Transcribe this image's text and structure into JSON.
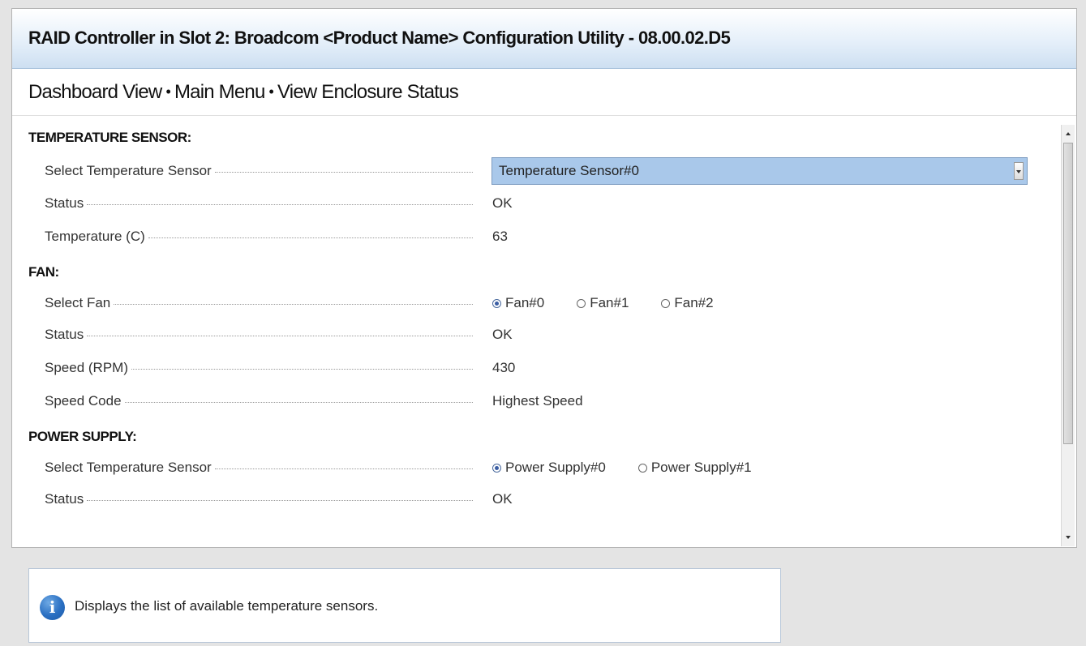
{
  "window": {
    "title": "RAID Controller in Slot 2: Broadcom <Product Name> Configuration Utility - 08.00.02.D5"
  },
  "breadcrumb": {
    "items": [
      "Dashboard View",
      "Main Menu",
      "View Enclosure Status"
    ],
    "separator": "•"
  },
  "temperature_sensor": {
    "heading": "TEMPERATURE SENSOR:",
    "select_label": "Select Temperature Sensor",
    "select_value": "Temperature Sensor#0",
    "status_label": "Status",
    "status_value": "OK",
    "temperature_label": "Temperature (C)",
    "temperature_value": "63"
  },
  "fan": {
    "heading": "FAN:",
    "select_label": "Select Fan",
    "options": [
      "Fan#0",
      "Fan#1",
      "Fan#2"
    ],
    "selected_option": "Fan#0",
    "status_label": "Status",
    "status_value": "OK",
    "speed_label": "Speed (RPM)",
    "speed_value": "430",
    "speed_code_label": "Speed Code",
    "speed_code_value": "Highest Speed"
  },
  "power_supply": {
    "heading": "POWER SUPPLY:",
    "select_label": "Select Temperature Sensor",
    "options": [
      "Power Supply#0",
      "Power Supply#1"
    ],
    "selected_option": "Power Supply#0",
    "status_label": "Status",
    "status_value": "OK"
  },
  "help": {
    "icon": "info-icon",
    "text": "Displays the list of available temperature sensors."
  },
  "colors": {
    "title_gradient_end": "#cddff1",
    "select_highlight": "#a9c8ea",
    "radio_selected": "#3a5da3",
    "info_icon": "#2a6fc2"
  }
}
